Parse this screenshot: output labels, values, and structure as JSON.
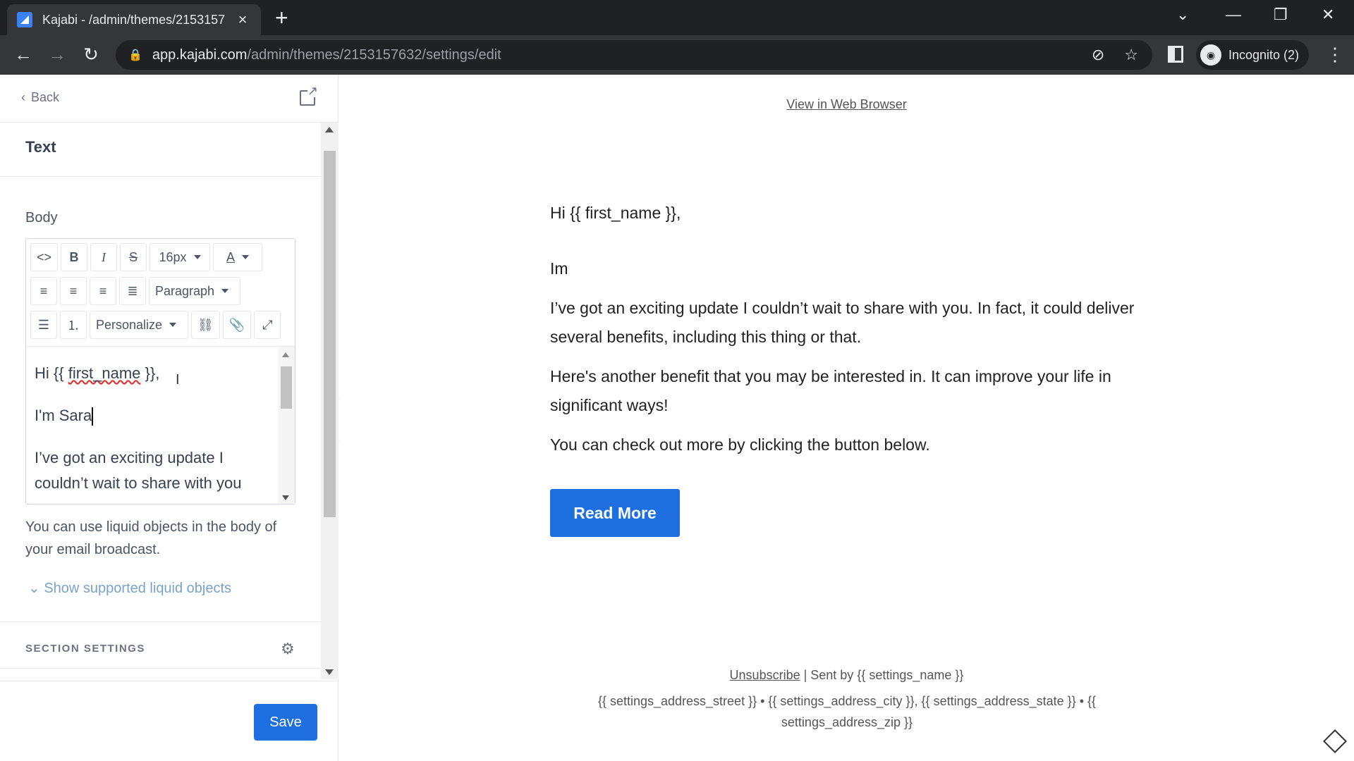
{
  "browser": {
    "tab_title": "Kajabi - /admin/themes/2153157",
    "url_domain": "app.kajabi.com",
    "url_path": "/admin/themes/2153157632/settings/edit",
    "profile_label": "Incognito (2)"
  },
  "left_panel": {
    "back_label": "Back",
    "section_title": "Text",
    "body_label": "Body",
    "toolbar": {
      "font_size": "16px",
      "block_format": "Paragraph",
      "personalize": "Personalize"
    },
    "editor_lines": {
      "greeting_prefix": "Hi {{ ",
      "greeting_var": "first_name",
      "greeting_suffix": " }},",
      "intro": "I'm Sara",
      "para1": "I’ve got an exciting update I couldn’t wait to share with you"
    },
    "hint": "You can use liquid objects in the body of your email broadcast.",
    "show_liquid": "Show supported liquid objects",
    "section_settings": "SECTION SETTINGS",
    "save_label": "Save"
  },
  "preview": {
    "view_in_browser": "View in Web Browser",
    "greeting": "Hi {{ first_name }},",
    "intro": "Im",
    "para1": "I’ve got an exciting update I couldn’t wait to share with you. In fact, it could deliver several benefits, including this thing or that.",
    "para2": "Here's another benefit that you may be interested in. It can improve your life in significant ways!",
    "para3": "You can check out more by clicking the button below.",
    "button": "Read More",
    "unsubscribe": "Unsubscribe",
    "sent_by": " | Sent by {{ settings_name }}",
    "address": "{{ settings_address_street }} • {{ settings_address_city }}, {{ settings_address_state }} • {{ settings_address_zip }}"
  }
}
